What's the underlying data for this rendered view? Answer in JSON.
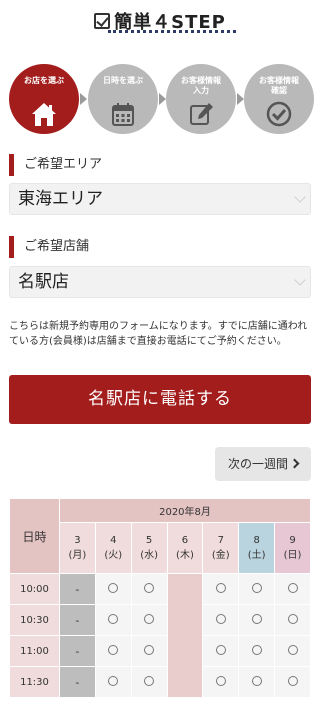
{
  "header": {
    "title": "簡単４STEP"
  },
  "steps": [
    {
      "label": "お店を選ぶ",
      "active": true,
      "icon": "home-icon"
    },
    {
      "label": "日時を選ぶ",
      "active": false,
      "icon": "calendar-icon"
    },
    {
      "label": "お客様情報\n入力",
      "active": false,
      "icon": "edit-icon"
    },
    {
      "label": "お客様情報\n確認",
      "active": false,
      "icon": "check-circle-icon"
    }
  ],
  "area": {
    "label": "ご希望エリア",
    "value": "東海エリア"
  },
  "store": {
    "label": "ご希望店舗",
    "value": "名駅店"
  },
  "note": "こちらは新規予約専用のフォームになります。すでに店舗に通われている方(会員様)は店舗まで直接お電話にてご予約ください。",
  "call_button": "名駅店に電話する",
  "next_week_button": "次の一週間",
  "calendar": {
    "day_header": "日時",
    "month": "2020年8月",
    "days": [
      {
        "date": "3",
        "dow": "(月)"
      },
      {
        "date": "4",
        "dow": "(火)"
      },
      {
        "date": "5",
        "dow": "(水)"
      },
      {
        "date": "6",
        "dow": "(木)"
      },
      {
        "date": "7",
        "dow": "(金)"
      },
      {
        "date": "8",
        "dow": "(土)"
      },
      {
        "date": "9",
        "dow": "(日)"
      }
    ],
    "rows": [
      {
        "time": "10:00",
        "slots": [
          "-",
          "○",
          "○",
          "",
          "○",
          "○",
          "○"
        ]
      },
      {
        "time": "10:30",
        "slots": [
          "-",
          "○",
          "○",
          "",
          "○",
          "○",
          "○"
        ]
      },
      {
        "time": "11:00",
        "slots": [
          "-",
          "○",
          "○",
          "",
          "○",
          "○",
          "○"
        ]
      },
      {
        "time": "11:30",
        "slots": [
          "-",
          "○",
          "○",
          "",
          "○",
          "○",
          "○"
        ]
      }
    ]
  },
  "colors": {
    "accent": "#a31d1d",
    "inactive_step": "#b9b9b9",
    "saturday": "#b9d4df",
    "sunday": "#e7c7d4"
  }
}
